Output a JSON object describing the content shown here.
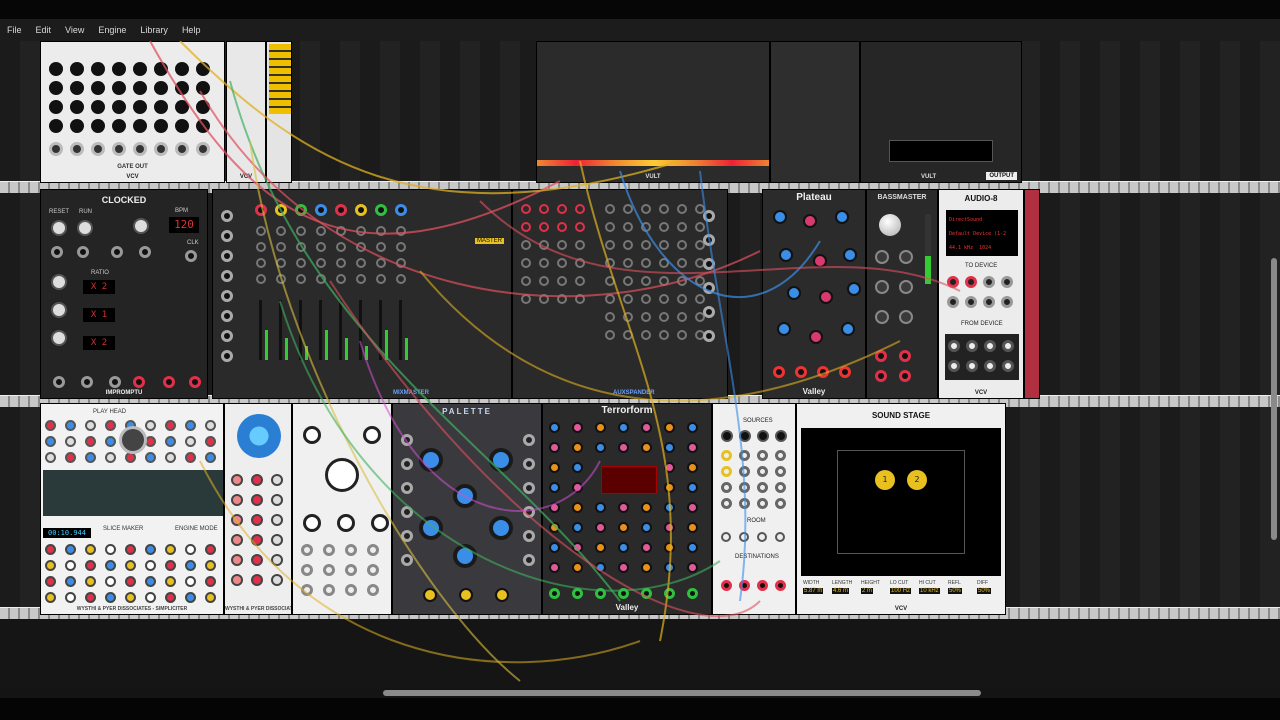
{
  "menu": {
    "items": [
      "File",
      "Edit",
      "View",
      "Engine",
      "Library",
      "Help"
    ]
  },
  "modules": {
    "gate_seq": {
      "footer": "GATE OUT",
      "brand": "VCV"
    },
    "vcv_narrow": {
      "brand": "VCV"
    },
    "vult_left": {
      "brand": "VULT"
    },
    "vult_right": {
      "brand": "VULT",
      "output_label": "OUTPUT"
    },
    "clocked": {
      "title": "CLOCKED",
      "bpm_label": "BPM",
      "bpm_value": "120",
      "ratio_label": "RATIO",
      "ratio_values": [
        "X 2",
        "X 1",
        "X 2"
      ],
      "reset_label": "RESET",
      "run_label": "RUN",
      "clk_label": "CLK",
      "brand": "IMPROMPTU"
    },
    "mixmaster": {
      "title": "MIXMASTER",
      "master_label": "MASTER"
    },
    "auxspander": {
      "title": "AUXSPANDER"
    },
    "plateau": {
      "title": "Plateau",
      "brand": "Valley"
    },
    "bassmaster": {
      "title": "BASSMASTER"
    },
    "audio8": {
      "title": "AUDIO-8",
      "driver": "DirectSound",
      "device": "Default Device (1-2",
      "rate": "44.1 kHz",
      "block": "1024",
      "to_device": "TO DEVICE",
      "from_device": "FROM DEVICE",
      "brand": "VCV"
    },
    "simpliciter": {
      "readout": "00:10.944",
      "footer": "WYSTHI & PYER DISSOCIATES - SIMPLICITER",
      "play_head": "PLAY HEAD",
      "slice_maker": "SLICE MAKER",
      "engine_mode": "ENGINE MODE"
    },
    "sampler_module": {
      "footer": "WYSTHI & PYER DISSOCIATES"
    },
    "palette": {
      "title": "PALETTE"
    },
    "terrorform": {
      "title": "Terrorform",
      "brand": "Valley"
    },
    "sources_room": {
      "sources_label": "SOURCES",
      "room_label": "ROOM",
      "destinations_label": "DESTINATIONS"
    },
    "sound_stage": {
      "title": "SOUND STAGE",
      "source_1": "1",
      "source_2": "2",
      "params": [
        "WIDTH",
        "LENGTH",
        "HEIGHT",
        "LO CUT",
        "HI CUT",
        "REFL",
        "DIFF"
      ],
      "values": [
        "5.87 m",
        "4.6 m",
        "2 m",
        "100 Hz",
        "10 kHz",
        "50%",
        "50%"
      ],
      "brand": "VCV"
    }
  },
  "colors": {
    "jack_red": "#e0304a",
    "jack_yellow": "#e8c020",
    "jack_green": "#30c040",
    "jack_blue": "#3a8ee8"
  }
}
